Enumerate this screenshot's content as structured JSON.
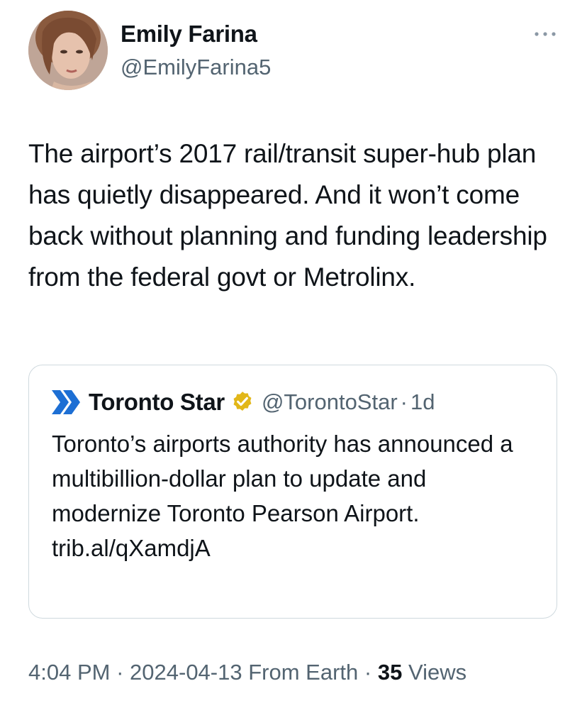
{
  "author": {
    "display_name": "Emily Farina",
    "handle": "@EmilyFarina5"
  },
  "tweet": {
    "text": "The airport’s 2017 rail/transit super-hub plan has quietly disappeared. And it won’t come back without planning and funding leadership from the federal govt or Metrolinx."
  },
  "quote": {
    "name": "Toronto Star",
    "handle": "@TorontoStar",
    "separator": "·",
    "time": "1d",
    "text": "Toronto’s airports authority has announced a multibillion-dollar plan to update and modernize Toronto Pearson Airport.",
    "link": "trib.al/qXamdjA"
  },
  "meta": {
    "time": "4:04 PM",
    "sep1": "·",
    "date": "2024-04-13",
    "source": "From Earth",
    "sep2": "·",
    "views_count": "35",
    "views_label": "Views"
  },
  "icons": {
    "more": "more-horizontal-icon",
    "verified": "verified-badge-icon",
    "publisher_logo": "toronto-star-logo-icon"
  },
  "colors": {
    "text_primary": "#0f1419",
    "text_secondary": "#536471",
    "border": "#cfd9de",
    "verified_gold": "#e2b719",
    "toronto_star_blue": "#1d6fd4"
  }
}
